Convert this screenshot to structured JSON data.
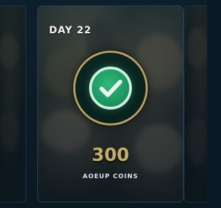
{
  "reward_card": {
    "day_label": "DAY 22",
    "status_icon": "checkmark-icon",
    "claimed": true,
    "amount": "300",
    "currency_label": "AOEUP COINS"
  },
  "colors": {
    "check_green": "#1f9a62",
    "badge_gold": "#b7a266",
    "amount_gold": "#c6ad6a",
    "background": "#0b1a26"
  }
}
